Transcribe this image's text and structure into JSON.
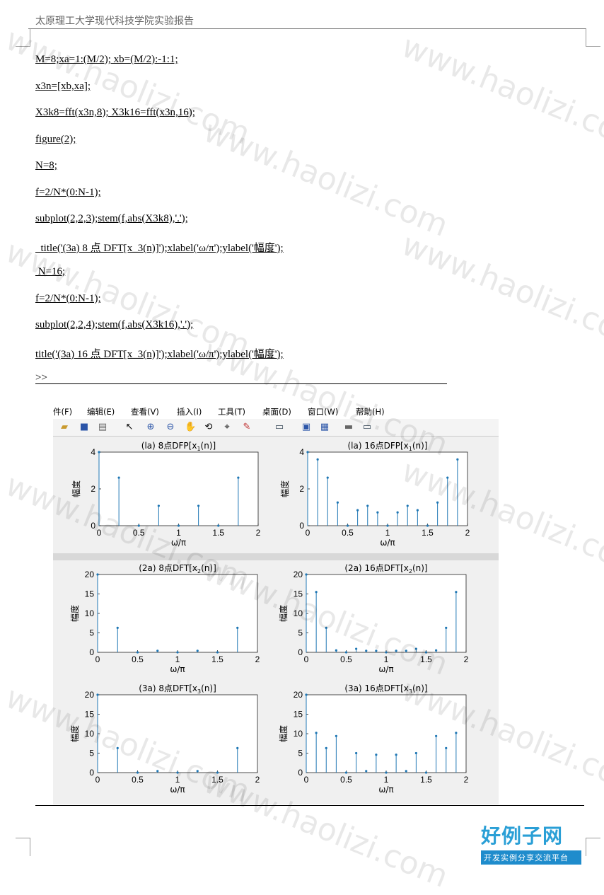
{
  "header": {
    "title": "太原理工大学现代科技学院实验报告"
  },
  "code_lines": [
    "M=8;xa=1:(M/2); xb=(M/2):-1:1;",
    "x3n=[xb,xa];",
    "X3k8=fft(x3n,8); X3k16=fft(x3n,16);",
    "figure(2);",
    "N=8;",
    "f=2/N*(0:N-1);",
    "subplot(2,2,3);stem(f,abs(X3k8),'.');",
    "  title('(3a) 8 点 DFT[x_3(n)]');xlabel('ω/π');ylabel('幅度');",
    " N=16;",
    "f=2/N*(0:N-1);",
    "subplot(2,2,4);stem(f,abs(X3k16),'.');",
    "title('(3a) 16 点 DFT[x_3(n)]');xlabel('ω/π');ylabel('幅度');",
    ">>"
  ],
  "figure_window": {
    "menu": [
      "件(F)",
      "编辑(E)",
      "查看(V)",
      "插入(I)",
      "工具(T)",
      "桌面(D)",
      "窗口(W)",
      "帮助(H)"
    ],
    "toolbar_icons": [
      "open-icon",
      "save-icon",
      "print-icon",
      "pointer-icon",
      "zoom-in-icon",
      "zoom-out-icon",
      "pan-icon",
      "rotate-icon",
      "datatip-icon",
      "brush-icon",
      "link-icon",
      "colorbar-icon",
      "legend-icon",
      "hide-tools-icon",
      "show-tools-icon"
    ]
  },
  "watermark": "www.haolizi.com",
  "logo": {
    "main": "好例子网",
    "sub": "开发实例分享交流平台"
  },
  "chart_data": [
    {
      "type": "stem",
      "title": "(la) 8点DFP[x1(n)]",
      "title_main": "(la) 8点DFP[x",
      "title_sub": "1",
      "title_end": "(n)]",
      "xlabel": "ω/π",
      "ylabel": "幅度",
      "xlim": [
        0,
        2
      ],
      "ylim": [
        0,
        4
      ],
      "xticks": [
        "0",
        "0.5",
        "1",
        "1.5",
        "2"
      ],
      "yticks": [
        "0",
        "2",
        "4"
      ],
      "x": [
        0,
        0.25,
        0.5,
        0.75,
        1,
        1.25,
        1.5,
        1.75
      ],
      "values": [
        4,
        2.61,
        0,
        1.08,
        0,
        1.08,
        0,
        2.61
      ]
    },
    {
      "type": "stem",
      "title": "(la) 16点DFP[x1(n)]",
      "title_main": "(la) 16点DFP[x",
      "title_sub": "1",
      "title_end": "(n)]",
      "xlabel": "ω/π",
      "ylabel": "幅度",
      "xlim": [
        0,
        2
      ],
      "ylim": [
        0,
        4
      ],
      "xticks": [
        "0",
        "0.5",
        "1",
        "1.5",
        "2"
      ],
      "yticks": [
        "0",
        "2",
        "4"
      ],
      "x": [
        0,
        0.125,
        0.25,
        0.375,
        0.5,
        0.625,
        0.75,
        0.875,
        1,
        1.125,
        1.25,
        1.375,
        1.5,
        1.625,
        1.75,
        1.875
      ],
      "values": [
        4,
        3.6,
        2.61,
        1.26,
        0,
        0.84,
        1.08,
        0.72,
        0,
        0.72,
        1.08,
        0.84,
        0,
        1.26,
        2.61,
        3.6
      ]
    },
    {
      "type": "stem",
      "title": "(2a) 8点DFT[x2(n)]",
      "title_main": "(2a) 8点DFT[x",
      "title_sub": "2",
      "title_end": "(n)]",
      "xlabel": "ω/π",
      "ylabel": "幅度",
      "xlim": [
        0,
        2
      ],
      "ylim": [
        0,
        20
      ],
      "xticks": [
        "0",
        "0.5",
        "1",
        "1.5",
        "2"
      ],
      "yticks": [
        "0",
        "5",
        "10",
        "15",
        "20"
      ],
      "x": [
        0,
        0.25,
        0.5,
        0.75,
        1,
        1.25,
        1.5,
        1.75
      ],
      "values": [
        20,
        6.3,
        0,
        0.4,
        0,
        0.4,
        0,
        6.3
      ]
    },
    {
      "type": "stem",
      "title": "(2a) 16点DFT[x2(n)]",
      "title_main": "(2a) 16点DFT[x",
      "title_sub": "2",
      "title_end": "(n)]",
      "xlabel": "ω/π",
      "ylabel": "幅度",
      "xlim": [
        0,
        2
      ],
      "ylim": [
        0,
        20
      ],
      "xticks": [
        "0",
        "0.5",
        "1",
        "1.5",
        "2"
      ],
      "yticks": [
        "0",
        "5",
        "10",
        "15",
        "20"
      ],
      "x": [
        0,
        0.125,
        0.25,
        0.375,
        0.5,
        0.625,
        0.75,
        0.875,
        1,
        1.125,
        1.25,
        1.375,
        1.5,
        1.625,
        1.75,
        1.875
      ],
      "values": [
        20,
        15.5,
        6.3,
        0.5,
        0,
        0.9,
        0.4,
        0.4,
        0,
        0.4,
        0.4,
        0.9,
        0,
        0.5,
        6.3,
        15.5
      ]
    },
    {
      "type": "stem",
      "title": "(3a) 8点DFT[x3(n)]",
      "title_main": "(3a) 8点DFT[x",
      "title_sub": "3",
      "title_end": "(n)]",
      "xlabel": "ω/π",
      "ylabel": "幅度",
      "xlim": [
        0,
        2
      ],
      "ylim": [
        0,
        20
      ],
      "xticks": [
        "0",
        "0.5",
        "1",
        "1.5",
        "2"
      ],
      "yticks": [
        "0",
        "5",
        "10",
        "15",
        "20"
      ],
      "x": [
        0,
        0.25,
        0.5,
        0.75,
        1,
        1.25,
        1.5,
        1.75
      ],
      "values": [
        20,
        6.3,
        0,
        0.4,
        0,
        0.4,
        0,
        6.3
      ]
    },
    {
      "type": "stem",
      "title": "(3a) 16点DFT[x3(n)]",
      "title_main": "(3a) 16点DFT[x",
      "title_sub": "3",
      "title_end": "(n)]",
      "xlabel": "ω/π",
      "ylabel": "幅度",
      "xlim": [
        0,
        2
      ],
      "ylim": [
        0,
        20
      ],
      "xticks": [
        "0",
        "0.5",
        "1",
        "1.5",
        "2"
      ],
      "yticks": [
        "0",
        "5",
        "10",
        "15",
        "20"
      ],
      "x": [
        0,
        0.125,
        0.25,
        0.375,
        0.5,
        0.625,
        0.75,
        0.875,
        1,
        1.125,
        1.25,
        1.375,
        1.5,
        1.625,
        1.75,
        1.875
      ],
      "values": [
        20,
        10.2,
        6.3,
        9.4,
        0,
        5,
        0.4,
        4.6,
        0,
        4.6,
        0.4,
        5,
        0,
        9.4,
        6.3,
        10.2
      ]
    }
  ]
}
